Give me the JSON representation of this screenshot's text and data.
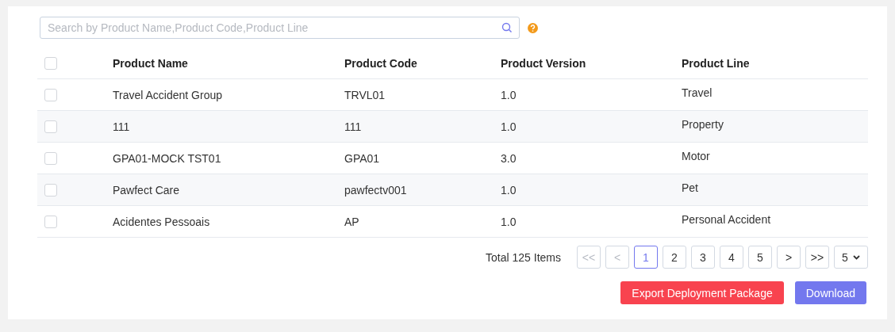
{
  "search": {
    "placeholder": "Search by Product Name,Product Code,Product Line"
  },
  "table": {
    "columns": [
      "Product Name",
      "Product Code",
      "Product Version",
      "Product Line"
    ],
    "header_checked": false,
    "rows": [
      {
        "checked": false,
        "cells": [
          "Travel Accident Group",
          "TRVL01",
          "1.0",
          "Travel"
        ]
      },
      {
        "checked": false,
        "cells": [
          "111",
          "111",
          "1.0",
          "Property"
        ]
      },
      {
        "checked": false,
        "cells": [
          "GPA01-MOCK TST01",
          "GPA01",
          "3.0",
          "Motor"
        ]
      },
      {
        "checked": false,
        "cells": [
          "Pawfect Care",
          "pawfectv001",
          "1.0",
          "Pet"
        ]
      },
      {
        "checked": false,
        "cells": [
          "Acidentes Pessoais",
          "AP",
          "1.0",
          "Personal Accident"
        ]
      }
    ]
  },
  "pagination": {
    "total": "Total 125 Items",
    "buttons": [
      {
        "label": "<<",
        "selected": false,
        "disabled": true
      },
      {
        "label": "<",
        "selected": false,
        "disabled": true
      },
      {
        "label": "1",
        "selected": true,
        "disabled": false
      },
      {
        "label": "2",
        "selected": false,
        "disabled": false
      },
      {
        "label": "3",
        "selected": false,
        "disabled": false
      },
      {
        "label": "4",
        "selected": false,
        "disabled": false
      },
      {
        "label": "5",
        "selected": false,
        "disabled": false
      },
      {
        "label": ">",
        "selected": false,
        "disabled": false
      },
      {
        "label": ">>",
        "selected": false,
        "disabled": false
      }
    ],
    "page_size": "5"
  },
  "actions": [
    {
      "label": "Export Deployment Package",
      "kind": "danger"
    },
    {
      "label": "Download",
      "kind": "primary"
    }
  ]
}
